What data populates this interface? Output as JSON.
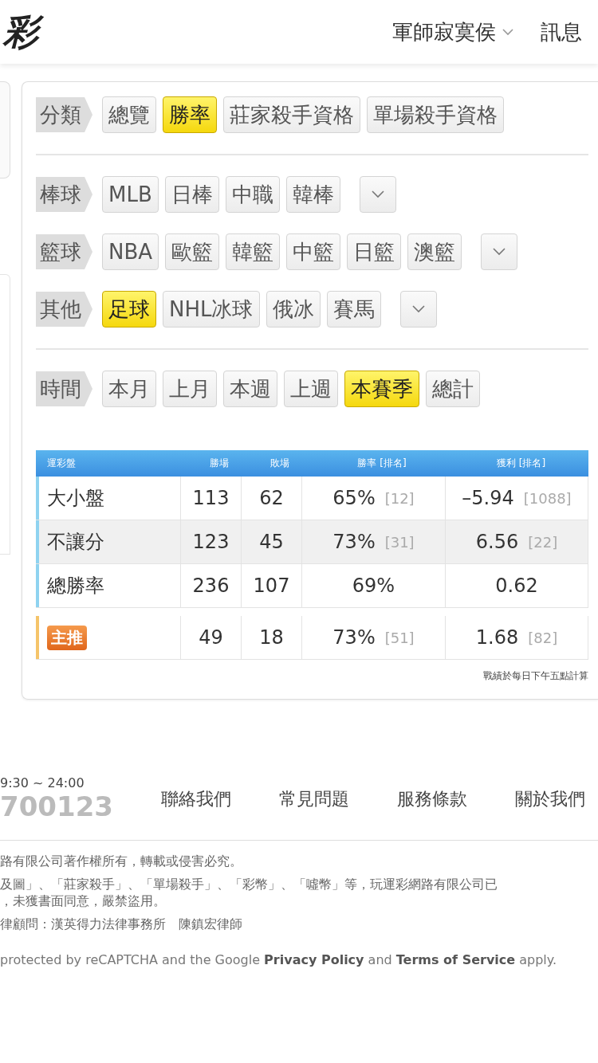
{
  "header": {
    "logo": "彩",
    "user": "軍師寂寞侯",
    "messages": "訊息"
  },
  "filter_sections": [
    [
      {
        "label": "分類",
        "has_more": false,
        "options": [
          {
            "label": "總覽",
            "selected": false
          },
          {
            "label": "勝率",
            "selected": true
          },
          {
            "label": "莊家殺手資格",
            "selected": false
          },
          {
            "label": "單場殺手資格",
            "selected": false
          }
        ]
      }
    ],
    [
      {
        "label": "棒球",
        "has_more": true,
        "options": [
          {
            "label": "MLB",
            "selected": false
          },
          {
            "label": "日棒",
            "selected": false
          },
          {
            "label": "中職",
            "selected": false
          },
          {
            "label": "韓棒",
            "selected": false
          }
        ]
      },
      {
        "label": "籃球",
        "has_more": true,
        "options": [
          {
            "label": "NBA",
            "selected": false
          },
          {
            "label": "歐籃",
            "selected": false
          },
          {
            "label": "韓籃",
            "selected": false
          },
          {
            "label": "中籃",
            "selected": false
          },
          {
            "label": "日籃",
            "selected": false
          },
          {
            "label": "澳籃",
            "selected": false
          }
        ]
      },
      {
        "label": "其他",
        "has_more": true,
        "options": [
          {
            "label": "足球",
            "selected": true
          },
          {
            "label": "NHL冰球",
            "selected": false
          },
          {
            "label": "俄冰",
            "selected": false
          },
          {
            "label": "賽馬",
            "selected": false
          }
        ]
      }
    ],
    [
      {
        "label": "時間",
        "has_more": false,
        "options": [
          {
            "label": "本月",
            "selected": false
          },
          {
            "label": "上月",
            "selected": false
          },
          {
            "label": "本週",
            "selected": false
          },
          {
            "label": "上週",
            "selected": false
          },
          {
            "label": "本賽季",
            "selected": true
          },
          {
            "label": "總計",
            "selected": false
          }
        ]
      }
    ]
  ],
  "table": {
    "columns": [
      "運彩盤",
      "勝場",
      "敗場",
      "勝率 [排名]",
      "獲利 [排名]"
    ],
    "rows": [
      {
        "kind": "normal",
        "color": "#8fd3f0",
        "shaded": false,
        "name": "大小盤",
        "wins": "113",
        "losses": "62",
        "win_rate": "65%",
        "win_rank": "[12]",
        "profit": "–5.94",
        "profit_rank": "[1088]"
      },
      {
        "kind": "normal",
        "color": "#8fd3f0",
        "shaded": true,
        "name": "不讓分",
        "wins": "123",
        "losses": "45",
        "win_rate": "73%",
        "win_rank": "[31]",
        "profit": "6.56",
        "profit_rank": "[22]"
      },
      {
        "kind": "normal",
        "color": "#8fd3f0",
        "shaded": false,
        "name": "總勝率",
        "wins": "236",
        "losses": "107",
        "win_rate": "69%",
        "profit": "0.62"
      },
      {
        "kind": "featured",
        "color": "#f5c46a",
        "shaded": false,
        "name": "主推",
        "wins": "49",
        "losses": "18",
        "win_rate": "73%",
        "win_rank": "[51]",
        "profit": "1.68",
        "profit_rank": "[82]"
      }
    ],
    "note": "戰績於每日下午五點計算"
  },
  "footer": {
    "hours": "9:30 ~ 24:00",
    "phone": "700123",
    "links": [
      "聯絡我們",
      "常見問題",
      "服務條款",
      "關於我們"
    ],
    "copyright": [
      "路有限公司著作權所有，轉載或侵害必究。",
      "及圖」、「莊家殺手」、「單場殺手」、「彩幣」、「噓幣」等，玩運彩網路有限公司已",
      "，未獲書面同意，嚴禁盜用。",
      "律顧問：漢英得力法律事務所　陳鎮宏律師"
    ],
    "recaptcha": "protected by reCAPTCHA and the Google **Privacy Policy** and **Terms of Service** apply."
  }
}
